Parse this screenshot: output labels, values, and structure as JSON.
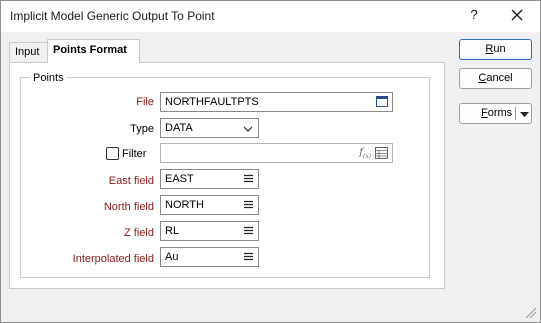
{
  "window": {
    "title": "Implicit Model Generic Output To Point",
    "help_label": "?"
  },
  "tabs": [
    {
      "label": "Input",
      "active": false
    },
    {
      "label": "Points Format",
      "active": true
    }
  ],
  "points_group": {
    "title": "Points",
    "file": {
      "label": "File",
      "value": "NORTHFAULTPTS",
      "icon": "browse-icon"
    },
    "type": {
      "label": "Type",
      "value": "DATA",
      "icon": "chevron-down-icon"
    },
    "filter": {
      "label": "Filter",
      "checked": false,
      "value": "",
      "icons": [
        "function-icon",
        "browse-icon"
      ]
    },
    "east_field": {
      "label": "East field",
      "value": "EAST",
      "icon": "list-icon"
    },
    "north_field": {
      "label": "North field",
      "value": "NORTH",
      "icon": "list-icon"
    },
    "z_field": {
      "label": "Z field",
      "value": "RL",
      "icon": "list-icon"
    },
    "interpolated_field": {
      "label": "Interpolated field",
      "value": "Au",
      "icon": "list-icon"
    }
  },
  "buttons": {
    "run_first": "R",
    "run_rest": "un",
    "cancel_first": "C",
    "cancel_rest": "ancel",
    "forms_first": "F",
    "forms_rest": "orms"
  },
  "colors": {
    "required_label": "#8b1a1a",
    "primary_button_border": "#2f6fc0"
  }
}
